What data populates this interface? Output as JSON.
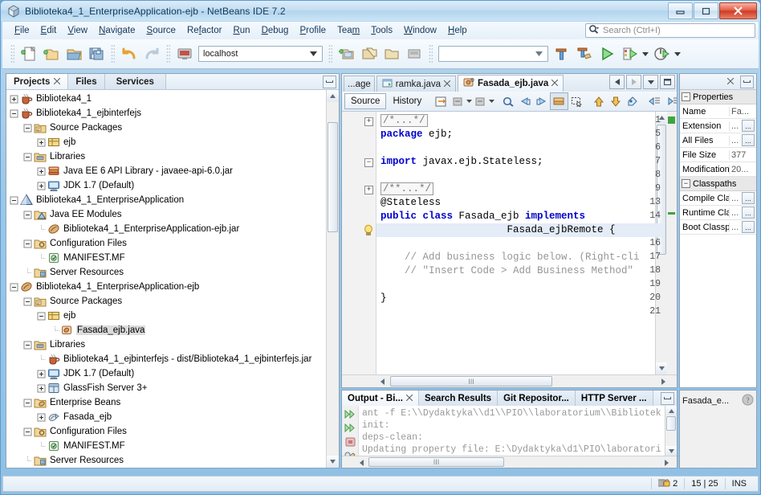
{
  "window": {
    "title": "Biblioteka4_1_EnterpriseApplication-ejb - NetBeans IDE 7.2",
    "app_icon": "netbeans-icon",
    "minimize_label": "Minimize",
    "maximize_label": "Maximize",
    "close_label": "Close"
  },
  "menu": {
    "items": [
      {
        "label": "File",
        "mnemonic": "F"
      },
      {
        "label": "Edit",
        "mnemonic": "E"
      },
      {
        "label": "View",
        "mnemonic": "V"
      },
      {
        "label": "Navigate",
        "mnemonic": "N"
      },
      {
        "label": "Source",
        "mnemonic": "S"
      },
      {
        "label": "Refactor",
        "mnemonic": "R"
      },
      {
        "label": "Run",
        "mnemonic": "R"
      },
      {
        "label": "Debug",
        "mnemonic": "D"
      },
      {
        "label": "Profile",
        "mnemonic": "P"
      },
      {
        "label": "Team",
        "mnemonic": "m"
      },
      {
        "label": "Tools",
        "mnemonic": "T"
      },
      {
        "label": "Window",
        "mnemonic": "W"
      },
      {
        "label": "Help",
        "mnemonic": "H"
      }
    ],
    "search_placeholder": "Search (Ctrl+I)"
  },
  "toolbar": {
    "config_combo_value": "localhost",
    "config_combo2_value": "",
    "buttons": [
      "new-file-icon",
      "new-project-icon",
      "open-project-icon",
      "save-all-icon",
      "undo-icon",
      "redo-icon",
      "server-icon",
      "new-ejb-icon",
      "copy-project-icon",
      "open-folder-icon",
      "deploy-icon",
      "build-project-icon",
      "clean-build-icon",
      "run-project-icon",
      "debug-project-icon",
      "profile-project-icon"
    ]
  },
  "projects_panel": {
    "tabs": [
      {
        "label": "Projects",
        "selected": true,
        "closable": true
      },
      {
        "label": "Files",
        "selected": false,
        "closable": false
      },
      {
        "label": "Services",
        "selected": false,
        "closable": false
      }
    ],
    "minimize_label": "Minimize Window",
    "tree": [
      {
        "indent": 0,
        "toggle": "plus",
        "icon": "coffee-cup-icon",
        "label": "Biblioteka4_1",
        "selected": false
      },
      {
        "indent": 0,
        "toggle": "minus",
        "icon": "coffee-cup-icon",
        "label": "Biblioteka4_1_ejbinterfejs",
        "selected": false
      },
      {
        "indent": 1,
        "toggle": "minus",
        "icon": "source-packages-icon",
        "label": "Source Packages",
        "selected": false
      },
      {
        "indent": 2,
        "toggle": "plus",
        "icon": "package-icon",
        "label": "ejb",
        "selected": false
      },
      {
        "indent": 1,
        "toggle": "minus",
        "icon": "libraries-icon",
        "label": "Libraries",
        "selected": false
      },
      {
        "indent": 2,
        "toggle": "plus",
        "icon": "library-books-icon",
        "label": "Java EE 6 API Library - javaee-api-6.0.jar",
        "selected": false
      },
      {
        "indent": 2,
        "toggle": "plus",
        "icon": "jdk-icon",
        "label": "JDK 1.7 (Default)",
        "selected": false
      },
      {
        "indent": 0,
        "toggle": "minus",
        "icon": "enterprise-app-icon",
        "label": "Biblioteka4_1_EnterpriseApplication",
        "selected": false
      },
      {
        "indent": 1,
        "toggle": "minus",
        "icon": "javaee-modules-icon",
        "label": "Java EE Modules",
        "selected": false
      },
      {
        "indent": 2,
        "toggle": "none",
        "icon": "ejb-jar-icon",
        "label": "Biblioteka4_1_EnterpriseApplication-ejb.jar",
        "selected": false
      },
      {
        "indent": 1,
        "toggle": "minus",
        "icon": "config-files-icon",
        "label": "Configuration Files",
        "selected": false
      },
      {
        "indent": 2,
        "toggle": "none",
        "icon": "manifest-icon",
        "label": "MANIFEST.MF",
        "selected": false
      },
      {
        "indent": 1,
        "toggle": "none",
        "icon": "server-resources-icon",
        "label": "Server Resources",
        "selected": false
      },
      {
        "indent": 0,
        "toggle": "minus",
        "icon": "ejb-jar-icon",
        "label": "Biblioteka4_1_EnterpriseApplication-ejb",
        "selected": false
      },
      {
        "indent": 1,
        "toggle": "minus",
        "icon": "source-packages-icon",
        "label": "Source Packages",
        "selected": false
      },
      {
        "indent": 2,
        "toggle": "minus",
        "icon": "package-icon",
        "label": "ejb",
        "selected": false
      },
      {
        "indent": 3,
        "toggle": "none",
        "icon": "ejb-class-icon",
        "label": "Fasada_ejb.java",
        "selected": true
      },
      {
        "indent": 1,
        "toggle": "minus",
        "icon": "libraries-icon",
        "label": "Libraries",
        "selected": false
      },
      {
        "indent": 2,
        "toggle": "none",
        "icon": "coffee-cup-icon",
        "label": "Biblioteka4_1_ejbinterfejs - dist/Biblioteka4_1_ejbinterfejs.jar",
        "selected": false
      },
      {
        "indent": 2,
        "toggle": "plus",
        "icon": "jdk-icon",
        "label": "JDK 1.7 (Default)",
        "selected": false
      },
      {
        "indent": 2,
        "toggle": "plus",
        "icon": "glassfish-icon",
        "label": "GlassFish Server 3+",
        "selected": false
      },
      {
        "indent": 1,
        "toggle": "minus",
        "icon": "enterprise-beans-icon",
        "label": "Enterprise Beans",
        "selected": false
      },
      {
        "indent": 2,
        "toggle": "plus",
        "icon": "bean-icon",
        "label": "Fasada_ejb",
        "selected": false
      },
      {
        "indent": 1,
        "toggle": "minus",
        "icon": "config-files-icon",
        "label": "Configuration Files",
        "selected": false
      },
      {
        "indent": 2,
        "toggle": "none",
        "icon": "manifest-icon",
        "label": "MANIFEST.MF",
        "selected": false
      },
      {
        "indent": 1,
        "toggle": "none",
        "icon": "server-resources-icon",
        "label": "Server Resources",
        "selected": false
      }
    ]
  },
  "editor": {
    "tabs": [
      {
        "label": "...age",
        "icon": "none",
        "active": false,
        "closable": false
      },
      {
        "label": "ramka.java",
        "icon": "java-form-icon",
        "active": false,
        "closable": true
      },
      {
        "label": "Fasada_ejb.java",
        "icon": "ejb-class-icon",
        "active": true,
        "closable": true
      }
    ],
    "tab_controls": [
      "scroll-left-icon",
      "scroll-right-icon",
      "tab-list-icon",
      "maximize-icon"
    ],
    "view_toggles": [
      {
        "label": "Source",
        "active": true
      },
      {
        "label": "History",
        "active": false
      }
    ],
    "toolbar_icons": [
      "last-edit-icon",
      "back-icon",
      "back-dropdown-icon",
      "forward-icon",
      "forward-dropdown-icon",
      "find-selection-icon",
      "previous-bookmark-icon",
      "next-bookmark-icon",
      "toggle-bookmark-icon",
      "toggle-rect-selection-icon",
      "previous-error-icon",
      "next-error-icon",
      "shift-line-left-icon",
      "shift-line-right-icon",
      "start-macro-icon",
      "stop-macro-icon"
    ],
    "lines": [
      {
        "num": "1",
        "fold": "plus",
        "tokens": [
          {
            "t": "fold",
            "v": "/*...*/"
          }
        ]
      },
      {
        "num": "5",
        "fold": "",
        "tokens": [
          {
            "t": "kw",
            "v": "package"
          },
          {
            "t": "p",
            "v": " ejb;"
          }
        ]
      },
      {
        "num": "6",
        "fold": "",
        "tokens": []
      },
      {
        "num": "7",
        "fold": "minus",
        "tokens": [
          {
            "t": "kw",
            "v": "import"
          },
          {
            "t": "p",
            "v": " javax.ejb.Stateless;"
          }
        ]
      },
      {
        "num": "8",
        "fold": "",
        "tokens": []
      },
      {
        "num": "9",
        "fold": "plus",
        "tokens": [
          {
            "t": "fold",
            "v": "/**...*/"
          }
        ]
      },
      {
        "num": "13",
        "fold": "",
        "tokens": [
          {
            "t": "p",
            "v": "@Stateless"
          }
        ]
      },
      {
        "num": "14",
        "fold": "",
        "tokens": [
          {
            "t": "kw",
            "v": "public class"
          },
          {
            "t": "p",
            "v": " Fasada_ejb "
          },
          {
            "t": "kw",
            "v": "implements"
          }
        ]
      },
      {
        "num": "",
        "fold": "bulb",
        "highlight": true,
        "tokens": [
          {
            "t": "p",
            "v": "                     Fasada_ejbRemote {"
          }
        ]
      },
      {
        "num": "16",
        "fold": "",
        "tokens": []
      },
      {
        "num": "17",
        "fold": "",
        "tokens": [
          {
            "t": "cm",
            "v": "    // Add business logic below. (Right-cli"
          }
        ]
      },
      {
        "num": "18",
        "fold": "",
        "tokens": [
          {
            "t": "cm",
            "v": "    // \"Insert Code > Add Business Method\""
          }
        ]
      },
      {
        "num": "19",
        "fold": "",
        "tokens": []
      },
      {
        "num": "20",
        "fold": "",
        "tokens": [
          {
            "t": "p",
            "v": "}"
          }
        ]
      },
      {
        "num": "21",
        "fold": "",
        "tokens": []
      }
    ]
  },
  "output_panel": {
    "tabs": [
      {
        "label": "Output - Bi...",
        "selected": true,
        "closable": true
      },
      {
        "label": "Search Results",
        "selected": false,
        "closable": false
      },
      {
        "label": "Git Repositor...",
        "selected": false,
        "closable": false
      },
      {
        "label": "HTTP Server ...",
        "selected": false,
        "closable": false
      }
    ],
    "minimize_label": "Minimize Window",
    "rail_icons": [
      "rerun-icon",
      "rerun-with-different-params-icon",
      "stop-icon",
      "clear-icon"
    ],
    "lines": [
      "ant -f E:\\\\Dydaktyka\\\\d1\\\\PIO\\\\laboratorium\\\\Bibliotek",
      "init:",
      "deps-clean:",
      "Updating property file: E:\\Dydaktyka\\d1\\PIO\\laboratori"
    ]
  },
  "properties_panel": {
    "title": "Properties",
    "minimize_label": "Minimize Window",
    "groups": [
      {
        "name": "Properties",
        "rows": [
          {
            "key": "Name",
            "value": "Fa...",
            "has_button": false
          },
          {
            "key": "Extension",
            "value": "...",
            "has_button": true
          },
          {
            "key": "All Files",
            "value": "...",
            "has_button": true
          },
          {
            "key": "File Size",
            "value": "377",
            "has_button": false
          },
          {
            "key": "Modification",
            "value": "20...",
            "has_button": false
          }
        ]
      },
      {
        "name": "Classpaths",
        "rows": [
          {
            "key": "Compile Clas",
            "value": "...",
            "has_button": true
          },
          {
            "key": "Runtime Cla",
            "value": "...",
            "has_button": true
          },
          {
            "key": "Boot Classp",
            "value": "...",
            "has_button": true
          }
        ]
      }
    ],
    "button_label": "..."
  },
  "navigator_panel": {
    "label": "Fasada_e...",
    "icon": "help-icon"
  },
  "status_bar": {
    "git_branch_count": "2",
    "caret_position": "15 | 25",
    "insert_mode": "INS"
  },
  "colors": {
    "accent": "#5b9bd0",
    "keyword": "#0000cc",
    "comment": "#969696",
    "selection": "#e4ecf8",
    "tree_selection": "#dcdcdc"
  }
}
